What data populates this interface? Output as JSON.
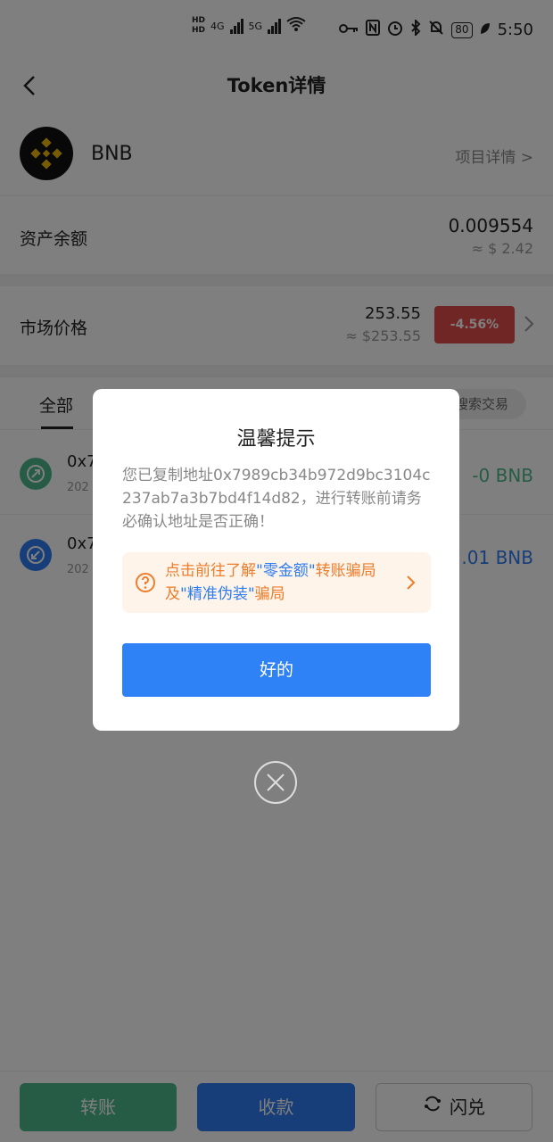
{
  "status_bar": {
    "time": "5:50",
    "battery": "80",
    "network_1": "4G",
    "network_2": "5G",
    "wifi_label": "6"
  },
  "header": {
    "title": "Token详情"
  },
  "token": {
    "name": "BNB",
    "project_link": "项目详情 >"
  },
  "balance": {
    "label": "资产余额",
    "value": "0.009554",
    "fiat": "≈ $ 2.42"
  },
  "price": {
    "label": "市场价格",
    "value": "253.55",
    "fiat": "≈ $253.55",
    "change": "-4.56%"
  },
  "tabs": {
    "all": "全部",
    "search_placeholder": "搜索交易"
  },
  "transactions": [
    {
      "addr": "0x7",
      "date": "202",
      "amount": "-0 BNB",
      "color": "#4cb98a"
    },
    {
      "addr": "0x7",
      "date": "202",
      "amount": ".01 BNB",
      "color": "#2f7cf0"
    }
  ],
  "bottom": {
    "transfer": "转账",
    "receive": "收款",
    "swap": "闪兑"
  },
  "modal": {
    "title": "温馨提示",
    "body": "您已复制地址0x7989cb34b972d9bc3104c237ab7a3b7bd4f14d82，进行转账前请务必确认地址是否正确！",
    "warn_prefix": "点击前往了解",
    "warn_hl1": "\"零金额\"",
    "warn_mid": "转账骗局及",
    "warn_hl2": "\"精准伪装\"",
    "warn_suffix": "骗局",
    "ok": "好的"
  },
  "colors": {
    "accent_blue": "#2f7cf0",
    "green": "#4cb98a",
    "red": "#e24c4c",
    "warn_orange": "#ee7d2c"
  }
}
